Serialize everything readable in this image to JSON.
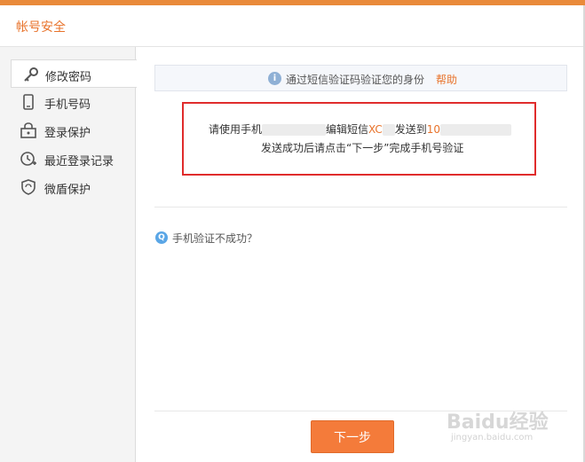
{
  "window": {
    "title": "帐号安全"
  },
  "sidebar": {
    "items": [
      {
        "label": "修改密码",
        "icon": "key-icon",
        "active": true
      },
      {
        "label": "手机号码",
        "icon": "phone-icon",
        "active": false
      },
      {
        "label": "登录保护",
        "icon": "lock-icon",
        "active": false
      },
      {
        "label": "最近登录记录",
        "icon": "clock-icon",
        "active": false
      },
      {
        "label": "微盾保护",
        "icon": "shield-icon",
        "active": false
      }
    ]
  },
  "info_bar": {
    "icon_glyph": "i",
    "text": "通过短信验证码验证您的身份",
    "help_link": "帮助"
  },
  "instruction": {
    "line1_prefix": "请使用手机",
    "line1_middle": "编辑短信",
    "line1_code": "XC",
    "line1_suffix": "发送到",
    "line1_number": "10",
    "line2": "发送成功后请点击“下一步”完成手机号验证"
  },
  "faq": {
    "icon_glyph": "Q",
    "label": "手机验证不成功？"
  },
  "next_button": {
    "label": "下一步"
  },
  "watermark": {
    "text": "Baidu经验",
    "url": "jingyan.baidu.com"
  },
  "colors": {
    "accent": "#e8732b",
    "button": "#f47b3a",
    "highlight_border": "#e02c2c",
    "info_icon": "#8fb0d5",
    "faq_icon": "#5aa6e6"
  }
}
